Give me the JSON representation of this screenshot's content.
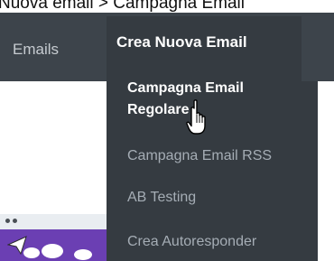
{
  "caption": "Nuova email > Campagna Email",
  "navbar": {
    "emails_label": "Emails",
    "create_label": "Crea Nuova Email"
  },
  "dropdown": {
    "items": [
      {
        "label_line1": "Campagna Email",
        "label_line2": "Regolare"
      },
      {
        "label": "Campagna Email RSS"
      },
      {
        "label": "AB Testing"
      },
      {
        "label": "Crea Autoresponder"
      }
    ]
  },
  "colors": {
    "navbar_bg": "#3d444b",
    "dropdown_bg": "#353b41",
    "preview_purple": "#6b3fb3"
  },
  "icons": [
    "hand-pointer-cursor-icon"
  ]
}
